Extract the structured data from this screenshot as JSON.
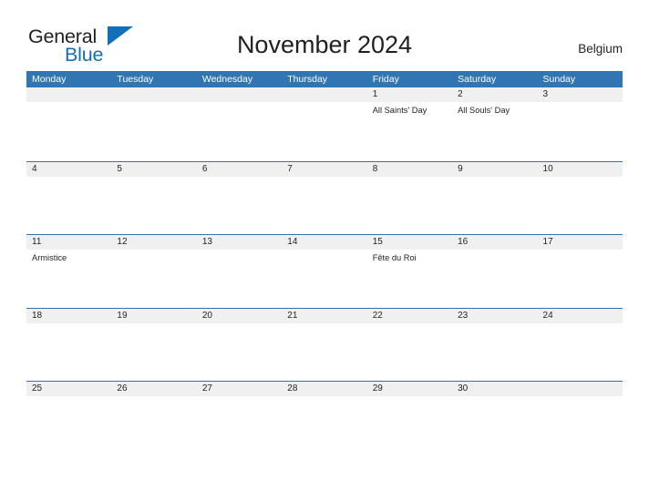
{
  "brand": {
    "name_part1": "General",
    "name_part2": "Blue",
    "flag_icon": "blue-flag-triangle-icon",
    "color_primary": "#1170b8",
    "color_text": "#231f20"
  },
  "header": {
    "title": "November 2024",
    "country": "Belgium"
  },
  "theme": {
    "header_blue": "#3176b3",
    "date_band_gray": "#f0f0f0",
    "row_border_blue": "#3176b3",
    "text_color": "#231f20"
  },
  "calendar": {
    "month": "November",
    "year": "2024",
    "weekday_headers": [
      "Monday",
      "Tuesday",
      "Wednesday",
      "Thursday",
      "Friday",
      "Saturday",
      "Sunday"
    ],
    "weeks": [
      {
        "days": [
          {
            "date": "",
            "events": []
          },
          {
            "date": "",
            "events": []
          },
          {
            "date": "",
            "events": []
          },
          {
            "date": "",
            "events": []
          },
          {
            "date": "1",
            "events": [
              "All Saints' Day"
            ]
          },
          {
            "date": "2",
            "events": [
              "All Souls' Day"
            ]
          },
          {
            "date": "3",
            "events": []
          }
        ]
      },
      {
        "days": [
          {
            "date": "4",
            "events": []
          },
          {
            "date": "5",
            "events": []
          },
          {
            "date": "6",
            "events": []
          },
          {
            "date": "7",
            "events": []
          },
          {
            "date": "8",
            "events": []
          },
          {
            "date": "9",
            "events": []
          },
          {
            "date": "10",
            "events": []
          }
        ]
      },
      {
        "days": [
          {
            "date": "11",
            "events": [
              "Armistice"
            ]
          },
          {
            "date": "12",
            "events": []
          },
          {
            "date": "13",
            "events": []
          },
          {
            "date": "14",
            "events": []
          },
          {
            "date": "15",
            "events": [
              "Fête du Roi"
            ]
          },
          {
            "date": "16",
            "events": []
          },
          {
            "date": "17",
            "events": []
          }
        ]
      },
      {
        "days": [
          {
            "date": "18",
            "events": []
          },
          {
            "date": "19",
            "events": []
          },
          {
            "date": "20",
            "events": []
          },
          {
            "date": "21",
            "events": []
          },
          {
            "date": "22",
            "events": []
          },
          {
            "date": "23",
            "events": []
          },
          {
            "date": "24",
            "events": []
          }
        ]
      },
      {
        "days": [
          {
            "date": "25",
            "events": []
          },
          {
            "date": "26",
            "events": []
          },
          {
            "date": "27",
            "events": []
          },
          {
            "date": "28",
            "events": []
          },
          {
            "date": "29",
            "events": []
          },
          {
            "date": "30",
            "events": []
          },
          {
            "date": "",
            "events": []
          }
        ]
      }
    ]
  }
}
